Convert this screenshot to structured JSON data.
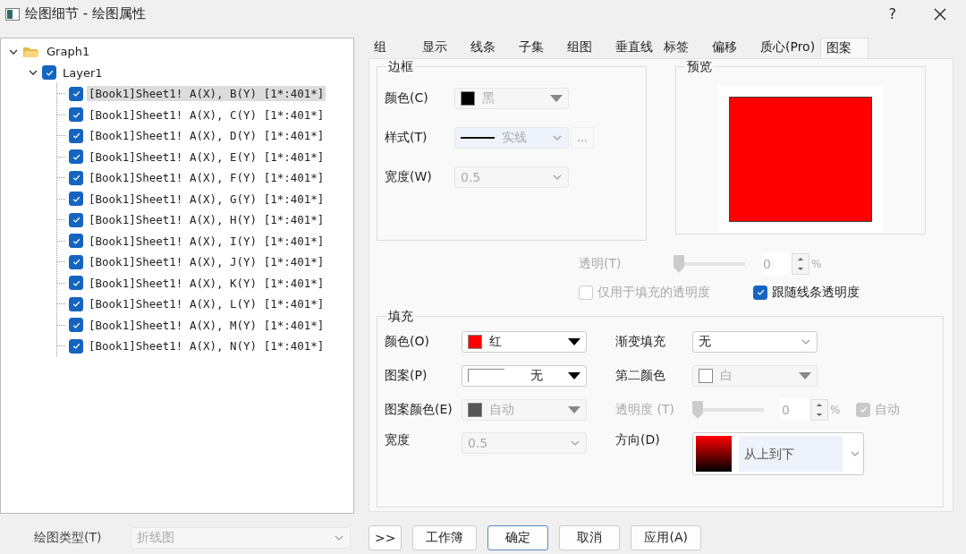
{
  "window": {
    "title": "绘图细节 - 绘图属性",
    "help": "?"
  },
  "tree": {
    "label": "Graph1",
    "expanded": true,
    "children": [
      {
        "label": "Layer1",
        "expanded": true,
        "checked": true,
        "children": [
          {
            "label": "[Book1]Sheet1! A(X), B(Y) [1*:401*]",
            "checked": true,
            "selected": true
          },
          {
            "label": "[Book1]Sheet1! A(X), C(Y) [1*:401*]",
            "checked": true,
            "selected": false
          },
          {
            "label": "[Book1]Sheet1! A(X), D(Y) [1*:401*]",
            "checked": true,
            "selected": false
          },
          {
            "label": "[Book1]Sheet1! A(X), E(Y) [1*:401*]",
            "checked": true,
            "selected": false
          },
          {
            "label": "[Book1]Sheet1! A(X), F(Y) [1*:401*]",
            "checked": true,
            "selected": false
          },
          {
            "label": "[Book1]Sheet1! A(X), G(Y) [1*:401*]",
            "checked": true,
            "selected": false
          },
          {
            "label": "[Book1]Sheet1! A(X), H(Y) [1*:401*]",
            "checked": true,
            "selected": false
          },
          {
            "label": "[Book1]Sheet1! A(X), I(Y) [1*:401*]",
            "checked": true,
            "selected": false
          },
          {
            "label": "[Book1]Sheet1! A(X), J(Y) [1*:401*]",
            "checked": true,
            "selected": false
          },
          {
            "label": "[Book1]Sheet1! A(X), K(Y) [1*:401*]",
            "checked": true,
            "selected": false
          },
          {
            "label": "[Book1]Sheet1! A(X), L(Y) [1*:401*]",
            "checked": true,
            "selected": false
          },
          {
            "label": "[Book1]Sheet1! A(X), M(Y) [1*:401*]",
            "checked": true,
            "selected": false
          },
          {
            "label": "[Book1]Sheet1! A(X), N(Y) [1*:401*]",
            "checked": true,
            "selected": false
          }
        ]
      }
    ]
  },
  "tabs": [
    {
      "label": "组",
      "selected": false
    },
    {
      "label": "显示",
      "selected": false
    },
    {
      "label": "线条",
      "selected": false
    },
    {
      "label": "子集",
      "selected": false
    },
    {
      "label": "组图",
      "selected": false
    },
    {
      "label": "垂直线",
      "selected": false
    },
    {
      "label": "标签",
      "selected": false
    },
    {
      "label": "偏移",
      "selected": false
    },
    {
      "label": "质心(Pro)",
      "selected": false
    },
    {
      "label": "图案",
      "selected": true
    }
  ],
  "border": {
    "title": "边框",
    "fields": [
      {
        "label": "颜色(C)",
        "kind": "color",
        "color": "#000000",
        "value": "黑",
        "disabled": true
      },
      {
        "label": "样式(T)",
        "kind": "line",
        "value": "实线",
        "disabled": true,
        "more": "..."
      },
      {
        "label": "宽度(W)",
        "kind": "list",
        "value": "0.5",
        "disabled": true
      }
    ]
  },
  "preview": {
    "title": "预览",
    "color": "#ff0000"
  },
  "transparency": {
    "label": "透明(T)",
    "level": 0,
    "value": "0",
    "unit": "%",
    "disabled": true
  },
  "options": [
    {
      "label": "仅用于填充的透明度",
      "checked": false,
      "disabled": true
    },
    {
      "label": "跟随线条透明度",
      "checked": true,
      "disabled": false
    }
  ],
  "fill": {
    "title": "填充",
    "left": [
      {
        "label": "颜色(O)",
        "kind": "color",
        "color": "#ff0000",
        "value": "红",
        "disabled": false
      },
      {
        "label": "图案(P)",
        "kind": "pattern",
        "value": "无",
        "disabled": false
      },
      {
        "label": "图案颜色(E)",
        "kind": "color",
        "color": "#555555",
        "value": "自动",
        "disabled": true
      },
      {
        "label": "宽度",
        "kind": "list",
        "value": "0.5",
        "disabled": true
      }
    ],
    "right": [
      {
        "label": "渐变填充",
        "kind": "list",
        "value": "无",
        "disabled": false
      },
      {
        "label": "第二颜色",
        "kind": "color",
        "color": "#ffffff",
        "value": "白",
        "disabled": true
      },
      {
        "label": "透明度 (T)",
        "kind": "slider",
        "level": 0,
        "value": "0",
        "unit": "%",
        "disabled": true,
        "auto": {
          "label": "自动",
          "checked": true
        }
      },
      {
        "label": "方向(D)",
        "kind": "gradient",
        "value": "从上到下",
        "disabled": false
      }
    ]
  },
  "plot_type": {
    "label": "绘图类型(T)",
    "value": "折线图",
    "disabled": true
  },
  "buttons": [
    {
      "label": ">>",
      "default": false
    },
    {
      "label": "工作簿",
      "default": false
    },
    {
      "label": "确定",
      "default": true
    },
    {
      "label": "取消",
      "default": false
    },
    {
      "label": "应用(A)",
      "default": false
    }
  ]
}
